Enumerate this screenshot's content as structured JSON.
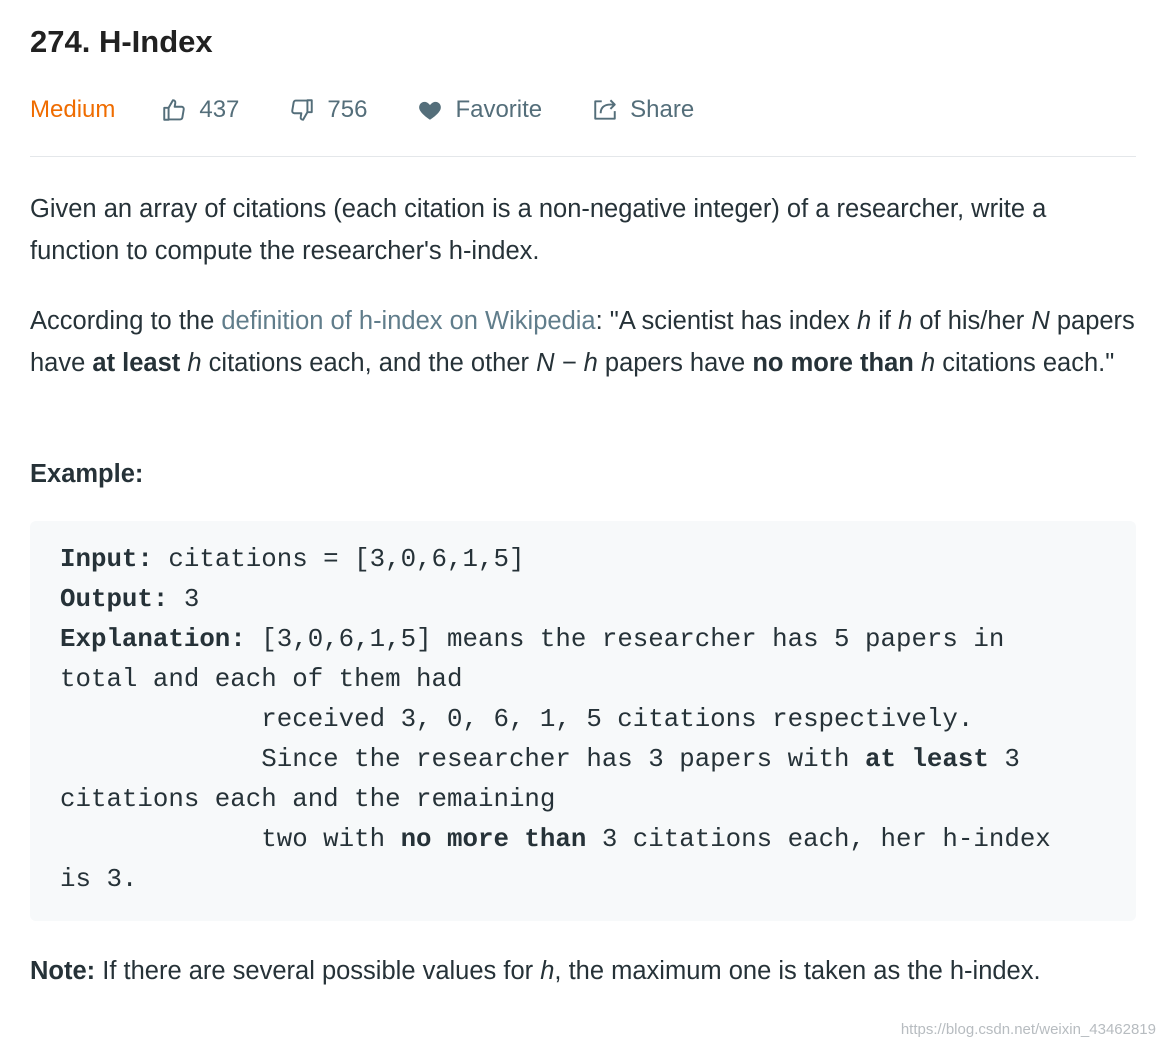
{
  "problem": {
    "title": "274. H-Index",
    "difficulty": "Medium",
    "likes": "437",
    "dislikes": "756",
    "favorite_label": "Favorite",
    "share_label": "Share"
  },
  "description": {
    "p1": "Given an array of citations (each citation is a non-negative integer) of a researcher, write a function to compute the researcher's h-index.",
    "p2": {
      "before_link": "According to the ",
      "link_text": "definition of h-index on Wikipedia",
      "t1": ": \"A scientist has index ",
      "h": "h",
      "t2": " if ",
      "t3": " of his/her ",
      "N": "N",
      "t4": " papers have ",
      "at_least": "at least",
      "t5": " citations each, and the other ",
      "n_minus_h": "N − h",
      "t6": " papers have ",
      "no_more_than": "no more than",
      "t7": " citations each.\""
    },
    "example_heading": "Example:",
    "note": {
      "label": "Note:",
      "t1": " If there are several possible values for ",
      "h": "h",
      "t2": ", the maximum one is taken as the h-index."
    }
  },
  "example": {
    "input_label": "Input:",
    "input_value": " citations = [3,0,6,1,5]",
    "output_label": "Output:",
    "output_value": " 3",
    "explanation_label": "Explanation:",
    "explanation_1": " [3,0,6,1,5] means the researcher has 5 papers in\ntotal and each of them had\n             received 3, 0, 6, 1, 5 citations respectively.\n             Since the researcher has 3 papers with ",
    "at_least": "at least",
    "explanation_2": " 3\ncitations each and the remaining\n             two with ",
    "no_more_than": "no more than",
    "explanation_3": " 3 citations each, her h-index\nis 3."
  },
  "watermark": "https://blog.csdn.net/weixin_43462819",
  "colors": {
    "difficulty": "#ef6c00",
    "link": "#607d8b",
    "meta": "#546e7a",
    "code_bg": "#f7f9fa"
  },
  "icons": [
    "thumbs-up-icon",
    "thumbs-down-icon",
    "heart-icon",
    "share-icon"
  ]
}
